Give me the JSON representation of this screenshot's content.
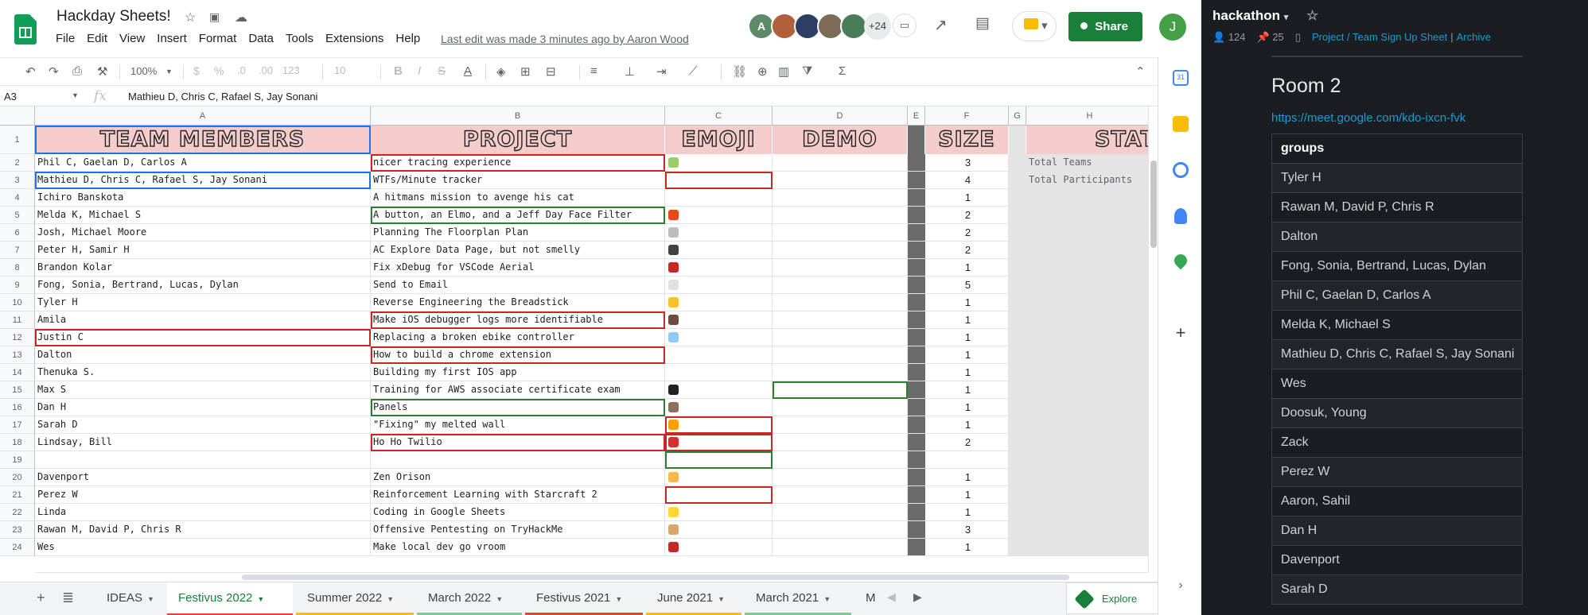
{
  "app": {
    "title": "Hackday Sheets!",
    "menus": [
      "File",
      "Edit",
      "View",
      "Insert",
      "Format",
      "Data",
      "Tools",
      "Extensions",
      "Help"
    ],
    "last_edit": "Last edit was made 3 minutes ago by Aaron Wood",
    "collaborators_more": "+24",
    "share_label": "Share",
    "account_initial": "J"
  },
  "toolbar": {
    "zoom": "100%",
    "currency": "$",
    "percent": "%",
    "dec_less": ".0",
    "dec_more": ".00",
    "format_more": "123",
    "font_size": "10"
  },
  "formula": {
    "cell_ref": "A3",
    "fx": "fx",
    "value": "Mathieu D, Chris C, Rafael S, Jay Sonani"
  },
  "columns": [
    "A",
    "B",
    "C",
    "D",
    "E",
    "F",
    "G",
    "H"
  ],
  "header_row": {
    "a": "TEAM MEMBERS",
    "b": "PROJECT",
    "c": "EMOJI",
    "d": "DEMO",
    "f": "SIZE",
    "h": "STAT"
  },
  "rows": [
    {
      "n": "2",
      "a": "Phil C, Gaelan D, Carlos A",
      "b": "nicer tracing experience",
      "f": "3",
      "h": "Total Teams"
    },
    {
      "n": "3",
      "a": "Mathieu D, Chris C, Rafael S, Jay Sonani",
      "b": "WTFs/Minute tracker",
      "f": "4",
      "h": "Total Participants"
    },
    {
      "n": "4",
      "a": "Ichiro Banskota",
      "b": "A hitmans mission to avenge his cat",
      "f": "1",
      "h": ""
    },
    {
      "n": "5",
      "a": "Melda K, Michael S",
      "b": "A button, an Elmo, and a Jeff Day Face Filter",
      "f": "2",
      "h": ""
    },
    {
      "n": "6",
      "a": "Josh, Michael Moore",
      "b": "Planning The Floorplan Plan",
      "f": "2",
      "h": ""
    },
    {
      "n": "7",
      "a": "Peter H, Samir H",
      "b": "AC Explore Data Page, but not smelly",
      "f": "2",
      "h": ""
    },
    {
      "n": "8",
      "a": "Brandon Kolar",
      "b": "Fix xDebug for VSCode Aerial",
      "f": "1",
      "h": ""
    },
    {
      "n": "9",
      "a": "Fong, Sonia, Bertrand, Lucas, Dylan",
      "b": "Send to Email",
      "f": "5",
      "h": ""
    },
    {
      "n": "10",
      "a": "Tyler H",
      "b": "Reverse Engineering the Breadstick",
      "f": "1",
      "h": ""
    },
    {
      "n": "11",
      "a": "Amila",
      "b": "Make iOS debugger logs more identifiable",
      "f": "1",
      "h": ""
    },
    {
      "n": "12",
      "a": "Justin C",
      "b": "Replacing a broken ebike controller",
      "f": "1",
      "h": ""
    },
    {
      "n": "13",
      "a": "Dalton",
      "b": "How to build a chrome extension",
      "f": "1",
      "h": ""
    },
    {
      "n": "14",
      "a": "Thenuka S.",
      "b": "Building my first IOS app",
      "f": "1",
      "h": ""
    },
    {
      "n": "15",
      "a": "Max S",
      "b": "Training for AWS associate certificate exam",
      "f": "1",
      "h": ""
    },
    {
      "n": "16",
      "a": "Dan H",
      "b": "Panels",
      "f": "1",
      "h": ""
    },
    {
      "n": "17",
      "a": "Sarah D",
      "b": "\"Fixing\" my melted wall",
      "f": "1",
      "h": ""
    },
    {
      "n": "18",
      "a": "Lindsay, Bill",
      "b": "Ho Ho Twilio",
      "f": "2",
      "h": ""
    },
    {
      "n": "19",
      "a": "",
      "b": "",
      "f": "",
      "h": ""
    },
    {
      "n": "20",
      "a": "Davenport",
      "b": "Zen Orison",
      "f": "1",
      "h": ""
    },
    {
      "n": "21",
      "a": "Perez W",
      "b": "Reinforcement Learning with Starcraft 2",
      "f": "1",
      "h": ""
    },
    {
      "n": "22",
      "a": "Linda",
      "b": "Coding in Google Sheets",
      "f": "1",
      "h": ""
    },
    {
      "n": "23",
      "a": "Rawan M, David P, Chris R",
      "b": "Offensive Pentesting on TryHackMe",
      "f": "3",
      "h": ""
    },
    {
      "n": "24",
      "a": "Wes",
      "b": "Make local dev go vroom",
      "f": "1",
      "h": ""
    }
  ],
  "emoji_colors": {
    "2": "#9ccc65",
    "5": "#e64a19",
    "6": "#bdbdbd",
    "7": "#424242",
    "8": "#c62828",
    "9": "#e0e0e0",
    "10": "#fbc02d",
    "11": "#6d4c41",
    "12": "#90caf9",
    "15": "#212121",
    "16": "#8d6e63",
    "17": "#ffa000",
    "18": "#d32f2f",
    "20": "#ffb74d",
    "22": "#fdd835",
    "23": "#d7a86e",
    "24": "#c62828"
  },
  "tabs": [
    "IDEAS",
    "Festivus 2022",
    "Summer 2022",
    "March 2022",
    "Festivus 2021",
    "June 2021",
    "March 2021",
    "M"
  ],
  "active_tab": "Festivus 2022",
  "explore_label": "Explore",
  "panel": {
    "channel": "hackathon",
    "members": "124",
    "pins": "25",
    "breadcrumb": "Project / Team Sign Up Sheet",
    "archive": "Archive",
    "room_title": "Room 2",
    "room_link": "https://meet.google.com/kdo-ixcn-fvk",
    "table_header": "groups",
    "groups": [
      "Tyler H",
      "Rawan M, David P, Chris R",
      "Dalton",
      "Fong, Sonia, Bertrand, Lucas, Dylan",
      "Phil C, Gaelan D, Carlos A",
      "Melda K, Michael S",
      "Mathieu D, Chris C, Rafael S, Jay Sonani",
      "Wes",
      "Doosuk, Young",
      "Zack",
      "Perez W",
      "Aaron, Sahil",
      "Dan H",
      "Davenport",
      "Sarah D"
    ]
  },
  "colors": {
    "share_green": "#188038",
    "header_pink": "#f4cccc",
    "link_blue": "#1d9bd1",
    "panel_bg": "#1a1d21"
  }
}
